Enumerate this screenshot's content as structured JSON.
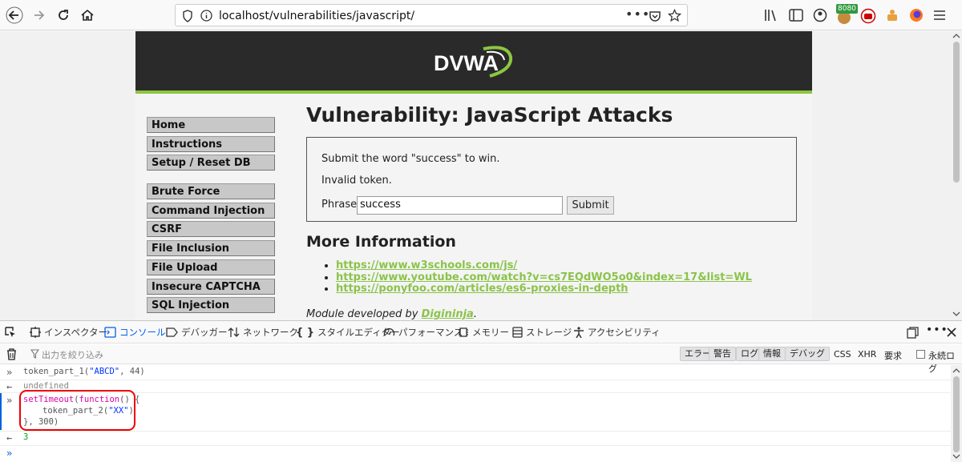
{
  "browser": {
    "url": "localhost/vulnerabilities/javascript/",
    "extension_badge": "8080"
  },
  "site": {
    "logo_text": "DVWA",
    "menu": [
      {
        "label": "Home"
      },
      {
        "label": "Instructions"
      },
      {
        "label": "Setup / Reset DB"
      },
      {
        "label": "Brute Force"
      },
      {
        "label": "Command Injection"
      },
      {
        "label": "CSRF"
      },
      {
        "label": "File Inclusion"
      },
      {
        "label": "File Upload"
      },
      {
        "label": "Insecure CAPTCHA"
      },
      {
        "label": "SQL Injection"
      }
    ],
    "title": "Vulnerability: JavaScript Attacks",
    "box": {
      "line1": "Submit the word \"success\" to win.",
      "line2": "Invalid token.",
      "phrase_label": "Phrase",
      "phrase_value": "success",
      "submit_label": "Submit"
    },
    "more_title": "More Information",
    "links": [
      "https://www.w3schools.com/js/",
      "https://www.youtube.com/watch?v=cs7EQdWO5o0&index=17&list=WL",
      "https://ponyfoo.com/articles/es6-proxies-in-depth"
    ],
    "module_prefix": "Module developed by ",
    "module_author": "Digininja",
    "module_suffix": "."
  },
  "devtools": {
    "tabs": [
      {
        "label": "インスペクター",
        "icon": "inspector-icon"
      },
      {
        "label": "コンソール",
        "icon": "console-icon"
      },
      {
        "label": "デバッガー",
        "icon": "debugger-icon"
      },
      {
        "label": "ネットワーク",
        "icon": "network-icon"
      },
      {
        "label": "スタイルエディター",
        "icon": "style-editor-icon"
      },
      {
        "label": "パフォーマンス",
        "icon": "performance-icon"
      },
      {
        "label": "メモリー",
        "icon": "memory-icon"
      },
      {
        "label": "ストレージ",
        "icon": "storage-icon"
      },
      {
        "label": "アクセシビリティ",
        "icon": "accessibility-icon"
      }
    ],
    "active_tab": "コンソール",
    "filter_placeholder": "出力を絞り込み",
    "levels": [
      "エラー",
      "警告",
      "ログ",
      "情報",
      "デバッグ"
    ],
    "extra_filters": [
      "CSS",
      "XHR",
      "要求"
    ],
    "persist_label": "永続ログ",
    "console": {
      "cmd1_prefix": "token_part_1(",
      "cmd1_str": "\"ABCD\"",
      "cmd1_mid": ", 44)",
      "result1": "undefined",
      "cmd2_line1_kw1": "setTimeout",
      "cmd2_line1_kw2": "function",
      "cmd2_line1_rest": "() {",
      "cmd2_line2_fn": "token_part_2(",
      "cmd2_line2_str": "\"XX\"",
      "cmd2_line2_end": ")",
      "cmd2_line3": "}, 300)",
      "result2": "3"
    }
  },
  "colors": {
    "accent_green": "#8dc63f",
    "console_active": "#0060df",
    "highlight_box": "#e00000"
  }
}
